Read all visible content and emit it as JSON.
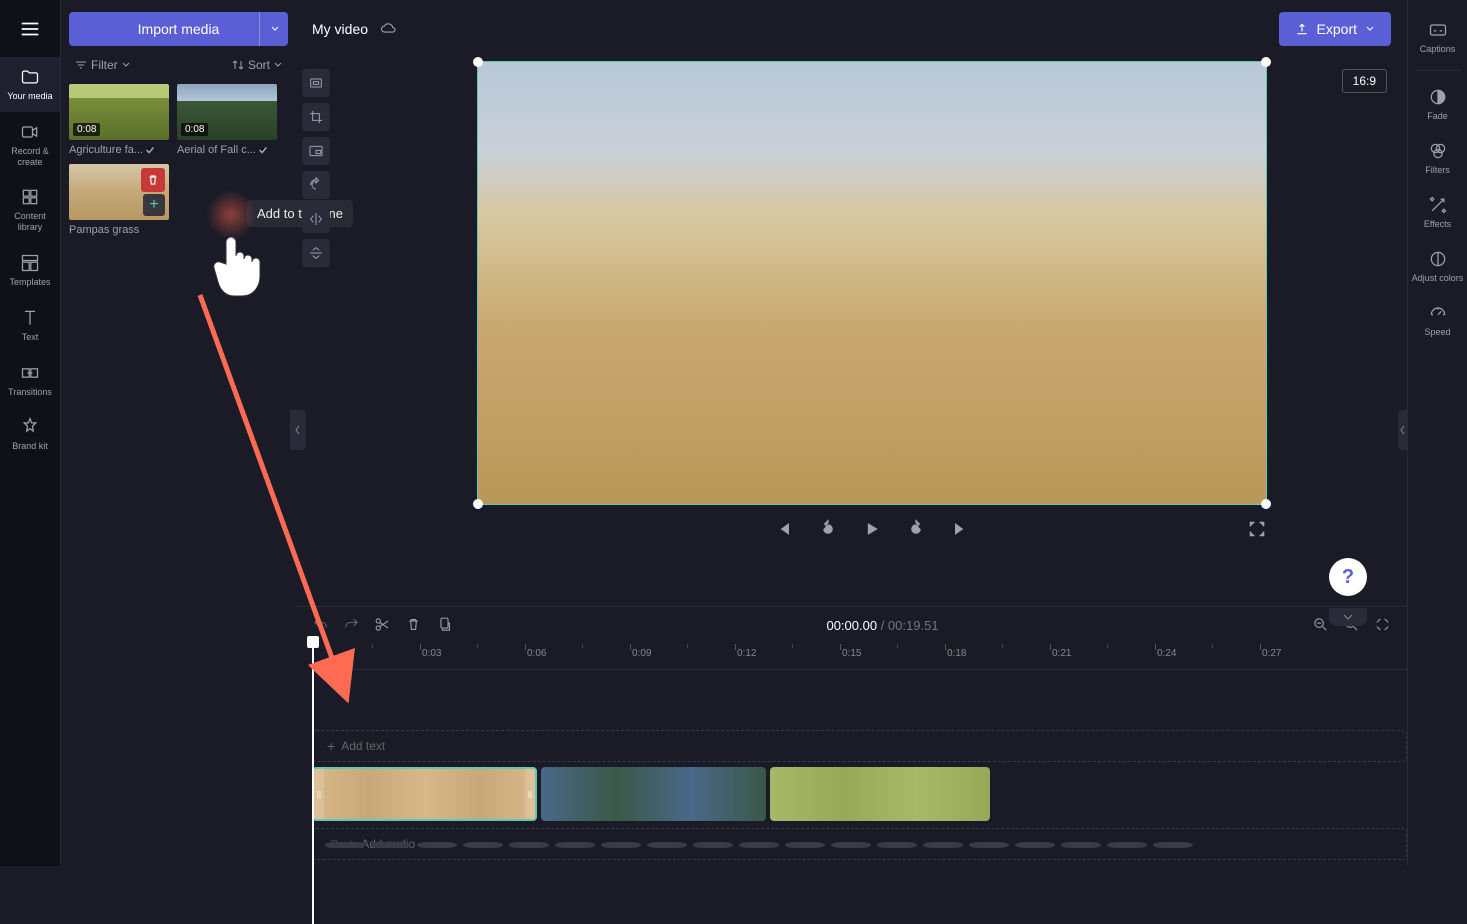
{
  "rail": {
    "your_media": "Your media",
    "record": "Record & create",
    "library": "Content library",
    "templates": "Templates",
    "text": "Text",
    "transitions": "Transitions",
    "brand": "Brand kit"
  },
  "media_panel": {
    "import": "Import media",
    "filter": "Filter",
    "sort": "Sort",
    "items": [
      {
        "dur": "0:08",
        "name": "Agriculture fa..."
      },
      {
        "dur": "0:08",
        "name": "Aerial of Fall c..."
      },
      {
        "dur": "",
        "name": "Pampas grass"
      }
    ],
    "tooltip": "Add to timeline"
  },
  "topbar": {
    "project": "My video",
    "export": "Export",
    "aspect": "16:9"
  },
  "playback": {
    "current": "00:00.00",
    "total": "00:19.51"
  },
  "ruler": [
    "0:03",
    "0:06",
    "0:09",
    "0:12",
    "0:15",
    "0:18",
    "0:21",
    "0:24",
    "0:27"
  ],
  "tracks": {
    "text": "Add text",
    "audio": "Add audio"
  },
  "right_rail": {
    "captions": "Captions",
    "fade": "Fade",
    "filters": "Filters",
    "effects": "Effects",
    "adjust": "Adjust colors",
    "speed": "Speed"
  }
}
